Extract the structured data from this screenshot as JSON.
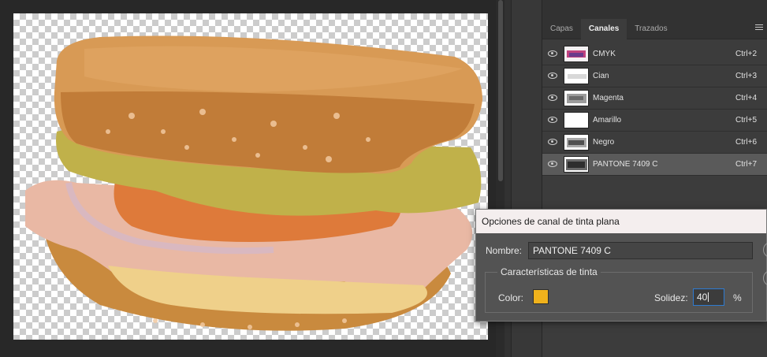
{
  "panel": {
    "tabs": [
      {
        "label": "Capas"
      },
      {
        "label": "Canales"
      },
      {
        "label": "Trazados"
      }
    ],
    "channels": [
      {
        "name": "CMYK",
        "shortcut": "Ctrl+2",
        "thumb": "composite"
      },
      {
        "name": "Cian",
        "shortcut": "Ctrl+3",
        "thumb": "light"
      },
      {
        "name": "Magenta",
        "shortcut": "Ctrl+4",
        "thumb": "gray"
      },
      {
        "name": "Amarillo",
        "shortcut": "Ctrl+5",
        "thumb": "white"
      },
      {
        "name": "Negro",
        "shortcut": "Ctrl+6",
        "thumb": "gray"
      },
      {
        "name": "PANTONE 7409 C",
        "shortcut": "Ctrl+7",
        "thumb": "dark",
        "selected": true
      }
    ]
  },
  "dialog": {
    "title": "Opciones de canal de tinta plana",
    "name_label": "Nombre:",
    "name_value": "PANTONE 7409 C",
    "group_title": "Características de tinta",
    "color_label": "Color:",
    "swatch_color": "#f0b21c",
    "solidity_label": "Solidez:",
    "solidity_value": "40",
    "percent": "%"
  }
}
